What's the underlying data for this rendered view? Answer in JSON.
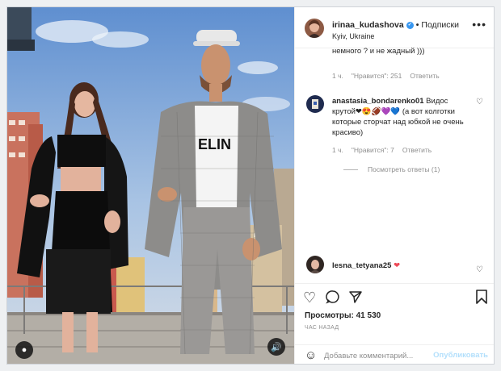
{
  "header": {
    "username": "irinaa_kudashova",
    "follow_label": "Подписки",
    "location": "Kyiv, Ukraine",
    "more_icon": "ellipsis-icon"
  },
  "comments": {
    "partial_text": "немного ? и не жадный )))",
    "first_meta": {
      "time": "1 ч.",
      "likes": "\"Нравится\": 251",
      "reply": "Ответить"
    },
    "second": {
      "username": "anastasia_bondarenko01",
      "text_a": "Видос",
      "text_b": "крутой",
      "emojis": "❤😍🏈💜💙",
      "text_c": "(а вот колготки которые сторчат над юбкой не очень красиво)",
      "time": "1 ч.",
      "likes": "\"Нравится\": 7",
      "reply": "Ответить",
      "view_replies": "Посмотреть ответы (1)"
    },
    "third": {
      "username": "lesna_tetyana25",
      "emoji": "❤"
    }
  },
  "actions": {
    "views": "Просмотры: 41 530",
    "time_ago": "ЧАС НАЗАД"
  },
  "add_comment": {
    "placeholder": "Добавьте комментарий...",
    "publish": "Опубликовать"
  },
  "media": {
    "shirt_text": "ELIN"
  },
  "colors": {
    "verified": "#3897f0",
    "publish_disabled": "#b2dffc",
    "heart_red": "#ed4956"
  }
}
